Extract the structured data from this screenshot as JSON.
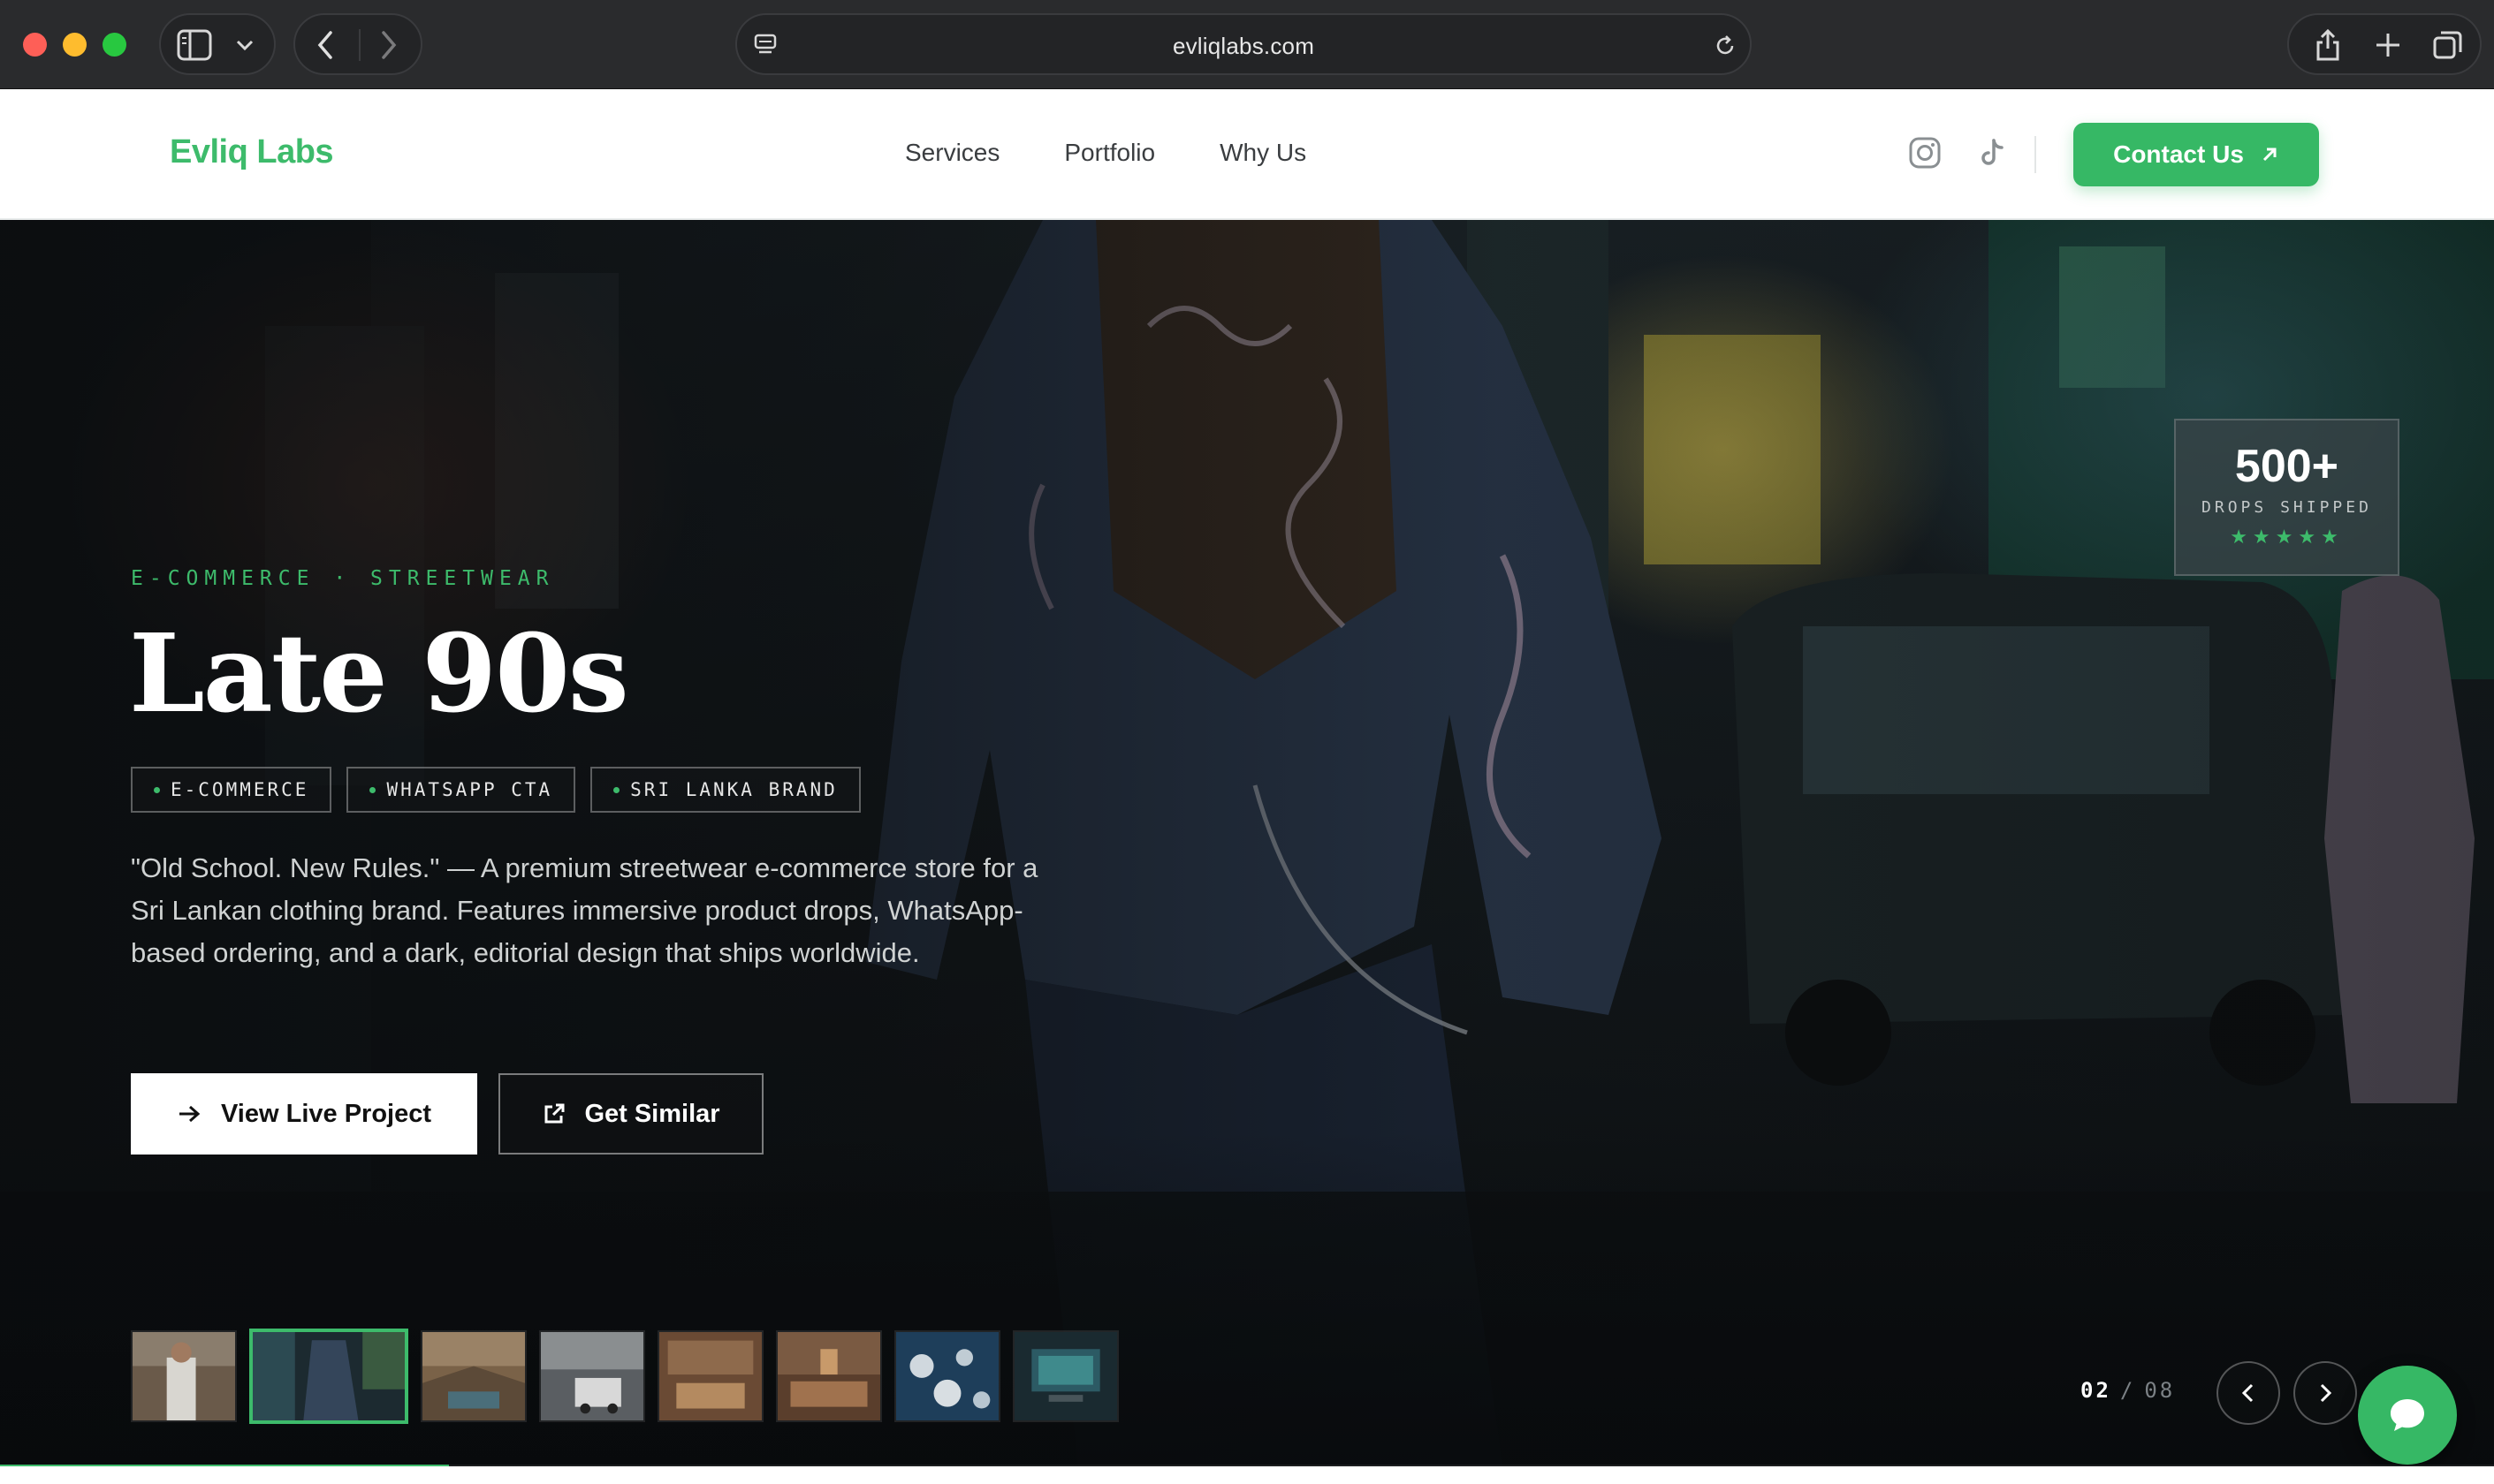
{
  "browser": {
    "url": "evliqlabs.com"
  },
  "header": {
    "logo": "Evliq Labs",
    "nav": [
      {
        "label": "Services"
      },
      {
        "label": "Portfolio"
      },
      {
        "label": "Why Us"
      }
    ],
    "social": [
      "instagram-icon",
      "tiktok-icon"
    ],
    "contact_label": "Contact Us"
  },
  "hero": {
    "eyebrow": "E-COMMERCE · STREETWEAR",
    "title": "Late 90s",
    "tags": [
      {
        "label": "E-COMMERCE"
      },
      {
        "label": "WHATSAPP CTA"
      },
      {
        "label": "SRI LANKA BRAND"
      }
    ],
    "description": "\"Old School. New Rules.\" — A premium streetwear e-commerce store for a Sri Lankan clothing brand. Features immersive product drops, WhatsApp-based ordering, and a dark, editorial design that ships worldwide.",
    "primary_cta": "View Live Project",
    "secondary_cta": "Get Similar",
    "stat": {
      "value": "500+",
      "label": "DROPS SHIPPED",
      "stars": "★★★★★"
    },
    "slide_current": "02",
    "slide_separator": "/",
    "slide_total": "08",
    "slide_progress": 0.18
  },
  "colors": {
    "brand_green": "#3dbb6b",
    "button_green": "#36b865"
  }
}
